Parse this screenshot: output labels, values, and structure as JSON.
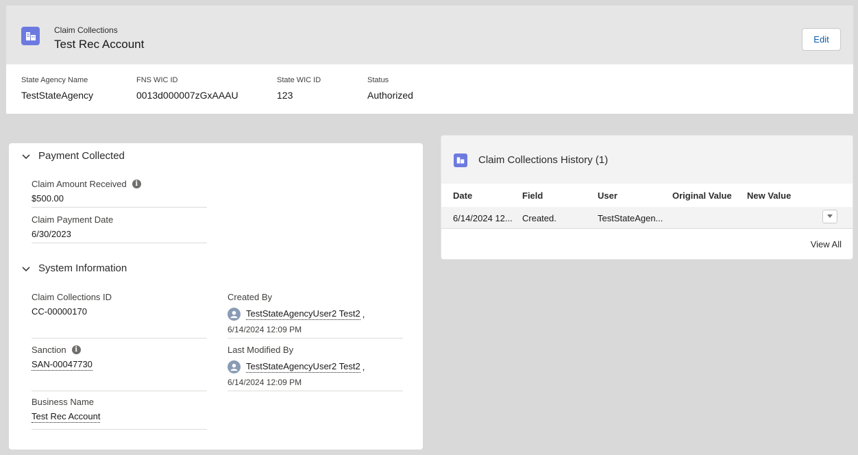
{
  "header": {
    "object_label": "Claim Collections",
    "record_name": "Test Rec Account",
    "edit_label": "Edit",
    "icon": "building-icon"
  },
  "highlights": [
    {
      "label": "State Agency Name",
      "value": "TestStateAgency"
    },
    {
      "label": "FNS WIC ID",
      "value": "0013d000007zGxAAAU"
    },
    {
      "label": "State WIC ID",
      "value": "123"
    },
    {
      "label": "Status",
      "value": "Authorized"
    }
  ],
  "payment_section": {
    "title": "Payment Collected",
    "fields": [
      {
        "label": "Claim Amount Received",
        "value": "$500.00"
      },
      {
        "label": "Claim Payment Date",
        "value": "6/30/2023"
      }
    ]
  },
  "system_section": {
    "title": "System Information",
    "claim_id": {
      "label": "Claim Collections ID",
      "value": "CC-00000170"
    },
    "sanction": {
      "label": "Sanction",
      "value": "SAN-00047730"
    },
    "business": {
      "label": "Business Name",
      "value": "Test Rec Account"
    },
    "created_by": {
      "label": "Created By",
      "user": "TestStateAgencyUser2 Test2",
      "sep": ",",
      "date": "6/14/2024 12:09 PM"
    },
    "modified_by": {
      "label": "Last Modified By",
      "user": "TestStateAgencyUser2 Test2",
      "sep": ",",
      "date": "6/14/2024 12:09 PM"
    }
  },
  "history": {
    "title": "Claim Collections History (1)",
    "columns": [
      "Date",
      "Field",
      "User",
      "Original Value",
      "New Value"
    ],
    "rows": [
      {
        "date": "6/14/2024 12...",
        "field": "Created.",
        "user": "TestStateAgen...",
        "original": "",
        "new": ""
      }
    ],
    "view_all": "View All"
  },
  "colors": {
    "accent": "#6c7ae0",
    "link": "#0b5cab",
    "background": "#d9d9d9"
  }
}
